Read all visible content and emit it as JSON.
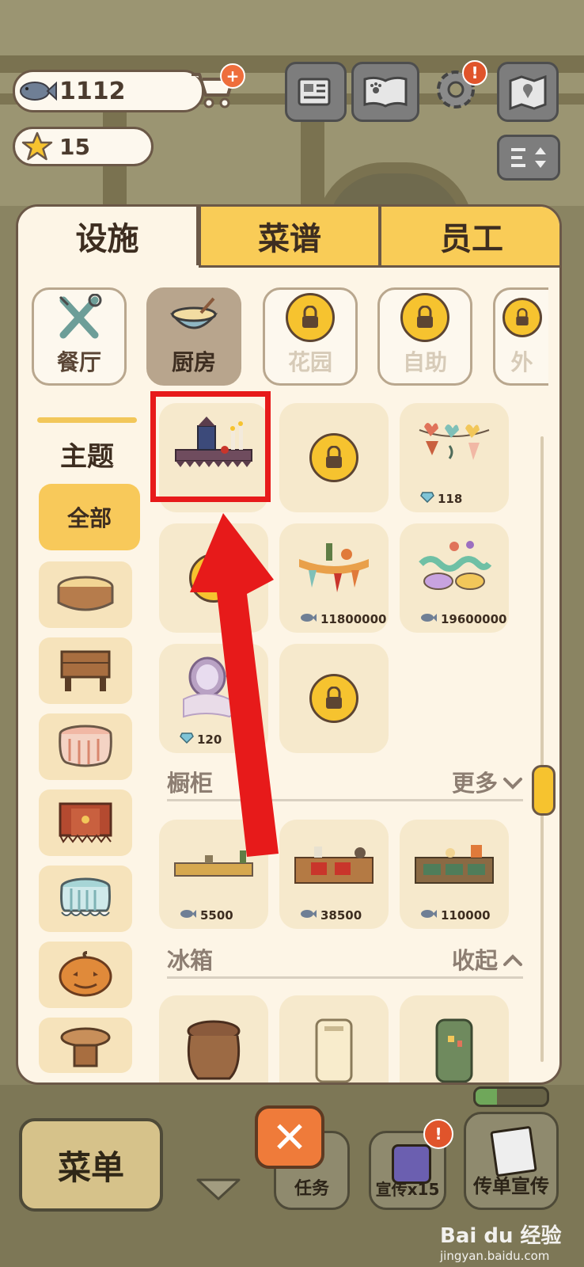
{
  "hud": {
    "fish_amount": "1112",
    "star_amount": "15",
    "shop_badge": "+",
    "settings_badge": "!"
  },
  "tabs": [
    {
      "label": "设施",
      "active": true
    },
    {
      "label": "菜谱",
      "active": false
    },
    {
      "label": "员工",
      "active": false
    }
  ],
  "categories": [
    {
      "label": "餐厅",
      "icon": "tools-icon",
      "state": "normal"
    },
    {
      "label": "厨房",
      "icon": "mixing-bowl-icon",
      "state": "active"
    },
    {
      "label": "花园",
      "icon": "lock-icon",
      "state": "locked"
    },
    {
      "label": "自助",
      "icon": "lock-icon",
      "state": "locked"
    },
    {
      "label": "外",
      "icon": "lock-icon",
      "state": "locked"
    }
  ],
  "sidebar": {
    "title": "主题",
    "all_label": "全部",
    "items": [
      "wood-stump-table-icon",
      "wooden-table-icon",
      "checkered-tablecloth-table-icon",
      "paw-tablecloth-table-icon",
      "lace-tablecloth-table-icon",
      "pumpkin-table-icon",
      "round-wood-table-icon"
    ]
  },
  "theme_grid": [
    {
      "art": "gothic-candle-counter-icon",
      "price": "",
      "currency": "fish",
      "locked": false,
      "highlighted": true
    },
    {
      "art": "locked-item-icon",
      "price": "",
      "currency": "",
      "locked": true
    },
    {
      "art": "tulip-garland-icon",
      "price": "118",
      "currency": "gem",
      "locked": false
    },
    {
      "art": "locked-item-icon",
      "price": "",
      "currency": "",
      "locked": true
    },
    {
      "art": "carrot-banner-icon",
      "price": "11800000",
      "currency": "fish",
      "locked": false
    },
    {
      "art": "carnival-mask-icon",
      "price": "19600000",
      "currency": "fish",
      "locked": false
    },
    {
      "art": "vintage-mirror-icon",
      "price": "120",
      "currency": "gem",
      "locked": false
    },
    {
      "art": "locked-item-icon",
      "price": "",
      "currency": "",
      "locked": true
    }
  ],
  "sections": [
    {
      "title": "橱柜",
      "toggle": "更多",
      "items": [
        {
          "art": "wood-counter-icon",
          "price": "5500"
        },
        {
          "art": "red-drawer-counter-icon",
          "price": "38500"
        },
        {
          "art": "green-drawer-counter-icon",
          "price": "110000"
        }
      ]
    },
    {
      "title": "冰箱",
      "toggle": "收起",
      "items": [
        {
          "art": "sack-icon",
          "price": ""
        },
        {
          "art": "retro-fridge-icon",
          "price": ""
        },
        {
          "art": "green-fridge-icon",
          "price": ""
        }
      ]
    }
  ],
  "bottom": {
    "menu_label": "菜单",
    "close_label": "✕",
    "task_label": "任务",
    "promo_label": "宣传x15",
    "flyer_label": "传单宣传",
    "progress": 0.3,
    "promo_badge": "!"
  },
  "watermark": {
    "brand": "Bai du 经验",
    "url": "jingyan.baidu.com"
  },
  "colors": {
    "accent": "#f9cc57",
    "highlight": "#e71a1a",
    "panel": "#fdf5e6"
  }
}
